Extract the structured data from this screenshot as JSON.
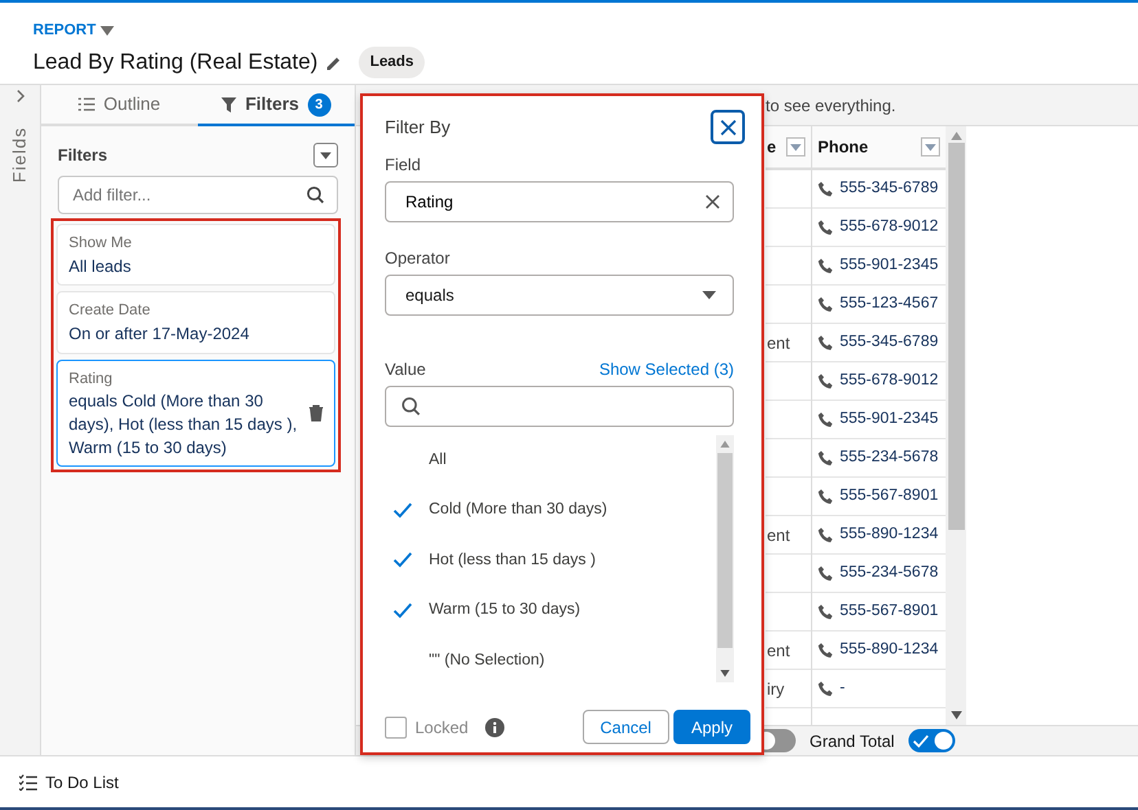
{
  "header": {
    "object_type": "REPORT",
    "title": "Lead By Rating (Real Estate)",
    "badge": "Leads"
  },
  "fields_strip": {
    "label": "Fields"
  },
  "tabs": [
    {
      "label": "Outline",
      "kind": "outline",
      "selected": false
    },
    {
      "label": "Filters",
      "kind": "filters",
      "selected": true,
      "count": "3"
    }
  ],
  "filters_panel": {
    "heading": "Filters",
    "placeholder": "Add filter...",
    "filters": [
      {
        "label": "Show Me",
        "value": "All leads",
        "selected": false
      },
      {
        "label": "Create Date",
        "value": "On or after 17-May-2024",
        "selected": false
      },
      {
        "label": "Rating",
        "value": "equals Cold (More than 30 days), Hot (less than 15 days ), Warm (15 to 30 days)",
        "selected": true
      }
    ]
  },
  "filter_popover": {
    "title": "Filter By",
    "field": {
      "label": "Field",
      "value": "Rating"
    },
    "operator": {
      "label": "Operator",
      "value": "equals"
    },
    "value": {
      "label": "Value",
      "show_selected": "Show Selected (3)",
      "options": [
        {
          "label": "All",
          "checked": false
        },
        {
          "label": "Cold (More than 30 days)",
          "checked": true
        },
        {
          "label": "Hot (less than 15 days )",
          "checked": true
        },
        {
          "label": "Warm (15 to 30 days)",
          "checked": true
        },
        {
          "label": "\"\" (No Selection)",
          "checked": false
        }
      ]
    },
    "locked": {
      "label": "Locked",
      "checked": false
    },
    "buttons": [
      {
        "label": "Cancel",
        "kind": "secondary"
      },
      {
        "label": "Apply",
        "kind": "primary"
      }
    ]
  },
  "notice": "to see everything.",
  "table": {
    "columns": [
      {
        "label": "e"
      },
      {
        "label": "Phone"
      }
    ],
    "rows": [
      {
        "phone": "555-345-6789"
      },
      {
        "phone": "555-678-9012"
      },
      {
        "phone": "555-901-2345"
      },
      {
        "phone": "555-123-4567"
      },
      {
        "column_1": "ent",
        "phone": "555-345-6789"
      },
      {
        "phone": "555-678-9012"
      },
      {
        "phone": "555-901-2345"
      },
      {
        "phone": "555-234-5678"
      },
      {
        "phone": "555-567-8901"
      },
      {
        "column_1": "ent",
        "phone": "555-890-1234"
      },
      {
        "phone": "555-234-5678"
      },
      {
        "phone": "555-567-8901"
      },
      {
        "column_1": "ent",
        "phone": "555-890-1234"
      },
      {
        "column_1": "iry",
        "phone": "-"
      }
    ]
  },
  "footer_toggles": [
    {
      "on": false
    },
    {
      "label": "Grand Total",
      "on": true
    }
  ],
  "bottom_bar": {
    "label": "To Do List"
  }
}
